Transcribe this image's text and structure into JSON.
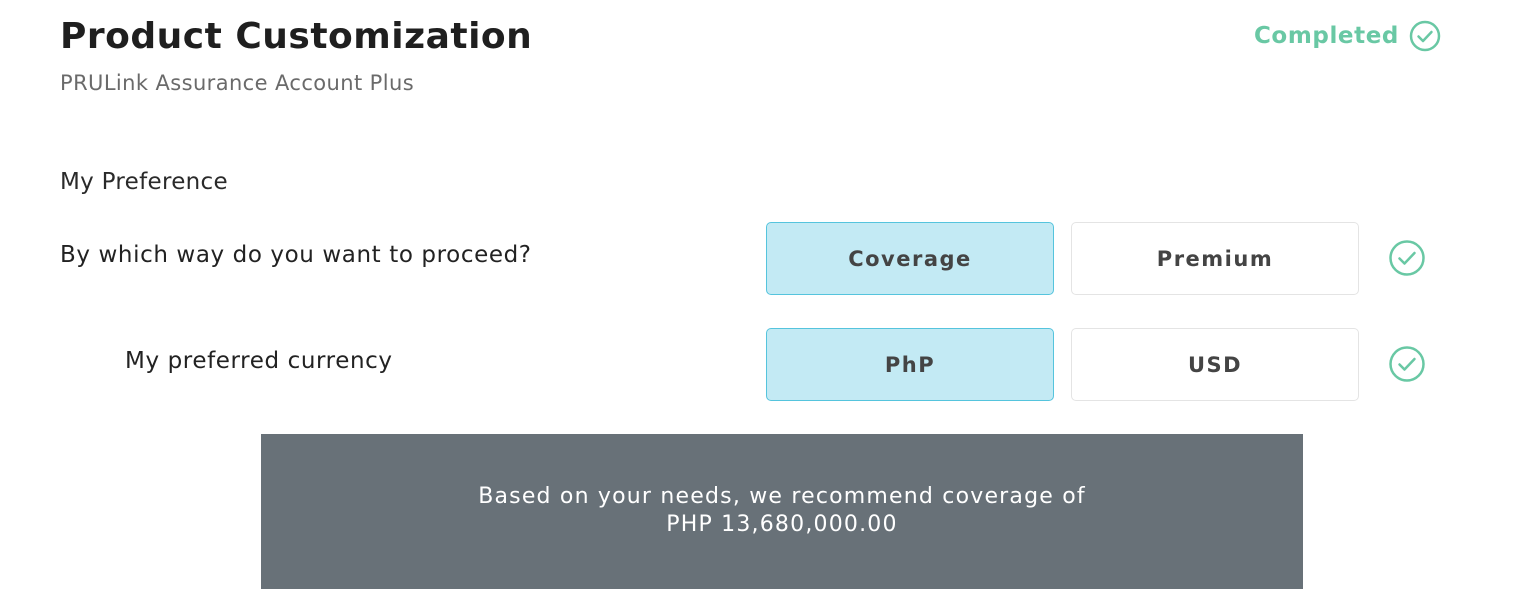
{
  "header": {
    "title": "Product Customization",
    "subtitle": "PRULink Assurance Account Plus",
    "status": "Completed",
    "status_icon": "check-circle-icon"
  },
  "preference": {
    "section_title": "My Preference",
    "proceed": {
      "question": "By which way do you want to proceed?",
      "options": [
        "Coverage",
        "Premium"
      ],
      "selected": "Coverage",
      "status_icon": "check-circle-icon"
    },
    "currency": {
      "question": "My preferred currency",
      "options": [
        "PhP",
        "USD"
      ],
      "selected": "PhP",
      "status_icon": "check-circle-icon"
    }
  },
  "recommendation": {
    "line1": "Based on your needs, we recommend coverage of",
    "line2": "PHP 13,680,000.00"
  },
  "colors": {
    "accent_green": "#69c8a4",
    "selected_fill": "#c3eaf4",
    "selected_border": "#55c4dd",
    "banner_bg": "#687178"
  }
}
